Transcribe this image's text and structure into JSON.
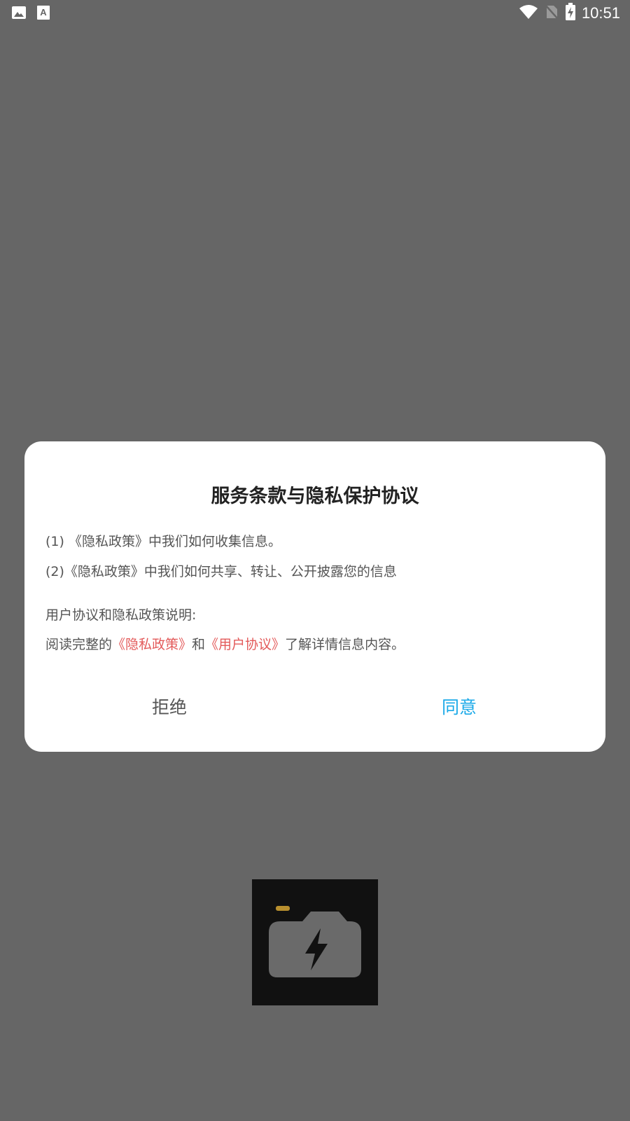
{
  "status_bar": {
    "time": "10:51",
    "left_icons": [
      "image-icon",
      "font-a-icon"
    ],
    "right_icons": [
      "wifi-icon",
      "no-sim-icon",
      "battery-charging-icon"
    ]
  },
  "dialog": {
    "title": "服务条款与隐私保护协议",
    "line1": "(1) 《隐私政策》中我们如何收集信息。",
    "line2": "(2)《隐私政策》中我们如何共享、转让、公开披露您的信息",
    "line3": "用户协议和隐私政策说明:",
    "line4": {
      "prefix": "阅读完整的",
      "privacy_link": "《隐私政策》",
      "middle": "和",
      "terms_link": "《用户协议》",
      "suffix": "了解详情信息内容。"
    },
    "reject_label": "拒绝",
    "agree_label": "同意"
  },
  "colors": {
    "overlay": "#666666",
    "link": "#e35a5a",
    "agree": "#1aa9e8",
    "accent_yellow": "#c9a24a"
  },
  "splash": {
    "logo_icon": "camera-flash-icon"
  }
}
